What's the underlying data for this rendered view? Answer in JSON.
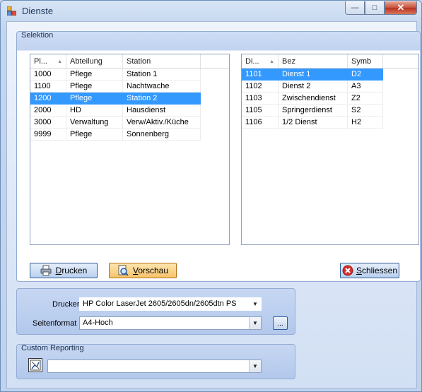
{
  "window": {
    "title": "Dienste"
  },
  "selektion": {
    "caption": "Selektion",
    "left_list": {
      "columns": [
        "Pl...",
        "Abteilung",
        "Station"
      ],
      "rows": [
        [
          "1000",
          "Pflege",
          "Station 1"
        ],
        [
          "1100",
          "Pflege",
          "Nachtwache"
        ],
        [
          "1200",
          "Pflege",
          "Station 2"
        ],
        [
          "2000",
          "HD",
          "Hausdienst"
        ],
        [
          "3000",
          "Verwaltung",
          "Verw/Aktiv./Küche"
        ],
        [
          "9999",
          "Pflege",
          "Sonnenberg"
        ]
      ],
      "selected_row": 2
    },
    "right_list": {
      "columns": [
        "Di...",
        "Bez",
        "Symb"
      ],
      "rows": [
        [
          "1101",
          "Dienst 1",
          "D2"
        ],
        [
          "1102",
          "Dienst 2",
          "A3"
        ],
        [
          "1103",
          "Zwischendienst",
          "Z2"
        ],
        [
          "1105",
          "Springerdienst",
          "S2"
        ],
        [
          "1106",
          "1/2 Dienst",
          "H2"
        ]
      ],
      "selected_row": 0
    }
  },
  "buttons": {
    "drucken": "Drucken",
    "vorschau": "Vorschau",
    "schliessen": "Schliessen",
    "ellipsis": "..."
  },
  "printer": {
    "drucker_label": "Drucker :",
    "drucker_value": "HP Color LaserJet 2605/2605dn/2605dtn PS",
    "seitenformat_label": "Seitenformat :",
    "seitenformat_value": "A4-Hoch"
  },
  "custom_reporting": {
    "caption": "Custom Reporting",
    "value": ""
  },
  "colors": {
    "selection": "#3399ff",
    "active_button": "#f7c36b",
    "close_button": "#c8503b"
  }
}
